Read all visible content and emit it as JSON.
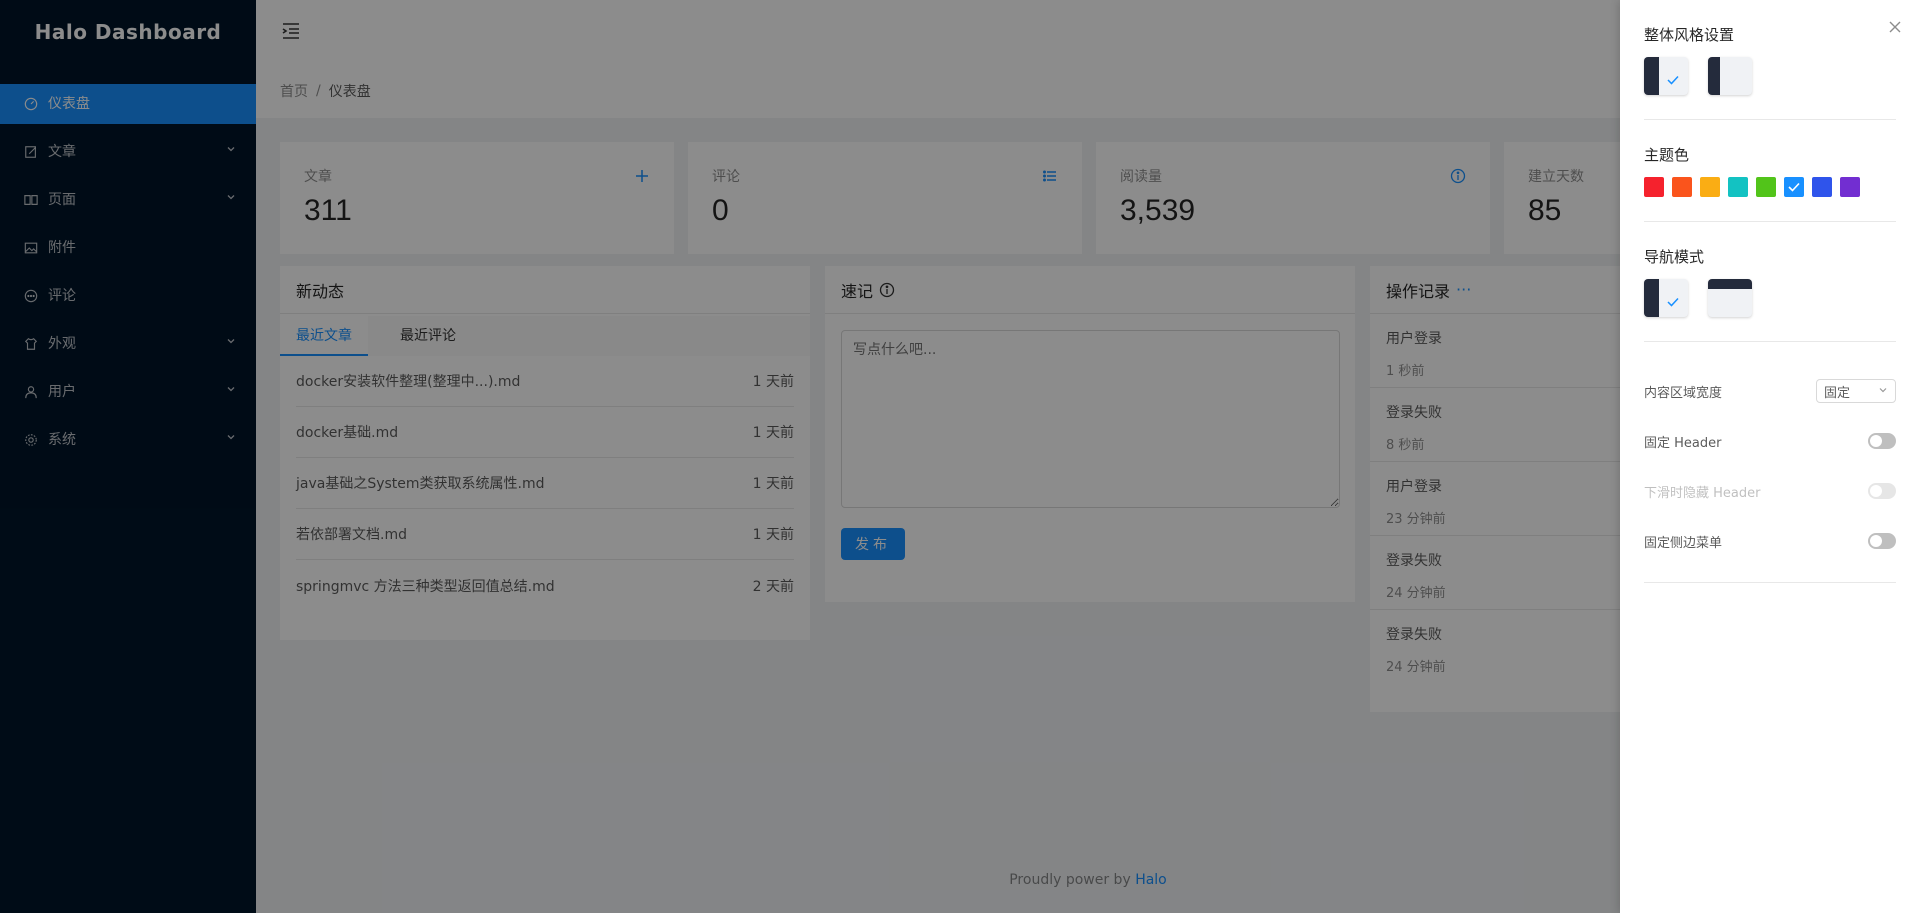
{
  "app": {
    "title": "Halo Dashboard"
  },
  "sidebar": {
    "items": [
      {
        "label": "仪表盘",
        "icon": "dashboard-icon",
        "active": true,
        "has_children": false
      },
      {
        "label": "文章",
        "icon": "form-icon",
        "active": false,
        "has_children": true
      },
      {
        "label": "页面",
        "icon": "read-icon",
        "active": false,
        "has_children": true
      },
      {
        "label": "附件",
        "icon": "picture-icon",
        "active": false,
        "has_children": false
      },
      {
        "label": "评论",
        "icon": "message-icon",
        "active": false,
        "has_children": false
      },
      {
        "label": "外观",
        "icon": "skin-icon",
        "active": false,
        "has_children": true
      },
      {
        "label": "用户",
        "icon": "user-icon",
        "active": false,
        "has_children": true
      },
      {
        "label": "系统",
        "icon": "setting-icon",
        "active": false,
        "has_children": true
      }
    ]
  },
  "breadcrumb": {
    "home": "首页",
    "separator": "/",
    "current": "仪表盘"
  },
  "stats": [
    {
      "label": "文章",
      "value": "311",
      "icon": "plus-icon"
    },
    {
      "label": "评论",
      "value": "0",
      "icon": "list-icon"
    },
    {
      "label": "阅读量",
      "value": "3,539",
      "icon": "info-circle-icon"
    },
    {
      "label": "建立天数",
      "value": "85",
      "icon": ""
    }
  ],
  "activity": {
    "title": "新动态",
    "tabs": [
      "最近文章",
      "最近评论"
    ],
    "posts": [
      {
        "title": "docker安装软件整理(整理中...).md",
        "time": "1 天前"
      },
      {
        "title": "docker基础.md",
        "time": "1 天前"
      },
      {
        "title": "java基础之System类获取系统属性.md",
        "time": "1 天前"
      },
      {
        "title": "若依部署文档.md",
        "time": "1 天前"
      },
      {
        "title": "springmvc 方法三种类型返回值总结.md",
        "time": "2 天前"
      }
    ]
  },
  "journal": {
    "title": "速记",
    "placeholder": "写点什么吧...",
    "publish_label": "发布"
  },
  "logs": {
    "title": "操作记录",
    "more": "···",
    "items": [
      {
        "title": "用户登录",
        "time": "1 秒前"
      },
      {
        "title": "登录失败",
        "time": "8 秒前"
      },
      {
        "title": "用户登录",
        "time": "23 分钟前"
      },
      {
        "title": "登录失败",
        "time": "24 分钟前"
      },
      {
        "title": "登录失败",
        "time": "24 分钟前"
      }
    ]
  },
  "footer": {
    "text": "Proudly power by",
    "link": "Halo"
  },
  "settings_drawer": {
    "style_title": "整体风格设置",
    "theme_color_title": "主题色",
    "nav_mode_title": "导航模式",
    "content_width_label": "内容区域宽度",
    "content_width_value": "固定",
    "fixed_header_label": "固定 Header",
    "hide_header_label": "下滑时隐藏 Header",
    "fixed_sidebar_label": "固定侧边菜单",
    "theme_colors": [
      "#f5222d",
      "#fa541c",
      "#faad14",
      "#13c2c2",
      "#52c41a",
      "#1890ff",
      "#2f54eb",
      "#722ed1"
    ],
    "selected_color_index": 5
  }
}
